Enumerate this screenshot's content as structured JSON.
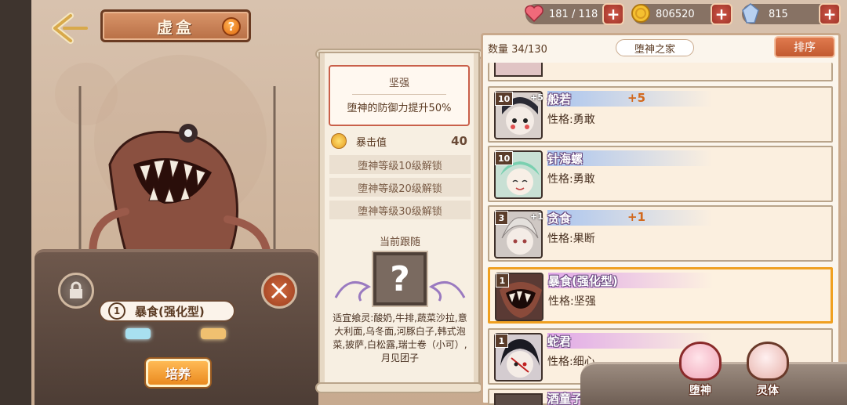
{
  "header": {
    "title": "虚盒",
    "help_icon": "question-icon",
    "back_icon": "back-arrow-icon"
  },
  "resources": {
    "stamina": {
      "value": "181 / 118",
      "icon": "heart-icon"
    },
    "gold": {
      "value": "806520",
      "icon": "coin-icon"
    },
    "crystal": {
      "value": "815",
      "icon": "crystal-icon"
    },
    "plus_label": "+"
  },
  "monster": {
    "level": "1",
    "name": "暴食(强化型)",
    "train_label": "培养"
  },
  "info": {
    "trait_title": "坚强",
    "trait_desc": "堕神的防御力提升50%",
    "crit_label": "暴击值",
    "crit_value": "40",
    "locks": [
      "堕神等级10级解锁",
      "堕神等级20级解锁",
      "堕神等级30级解锁"
    ],
    "follow_label": "当前跟随",
    "follow_placeholder": "?",
    "suitable_text": "适宜飨灵:酸奶,牛排,蔬菜沙拉,意大利面,乌冬面,河豚白子,韩式泡菜,披萨,白松露,瑞士卷（小可）,月见团子"
  },
  "list": {
    "count": "数量 34/130",
    "home_tag": "堕神之家",
    "sort_label": "排序",
    "cards": [
      {
        "level": "10",
        "plus_badge": "+5",
        "name": "般若",
        "plus_level": "+5",
        "personality": "性格:勇敢",
        "band": "blue",
        "selected": false
      },
      {
        "level": "10",
        "plus_badge": "",
        "name": "针海螺",
        "plus_level": "",
        "personality": "性格:勇敢",
        "band": "blue",
        "selected": false
      },
      {
        "level": "3",
        "plus_badge": "+1",
        "name": "贪食",
        "plus_level": "+1",
        "personality": "性格:果断",
        "band": "blue",
        "selected": false
      },
      {
        "level": "1",
        "plus_badge": "",
        "name": "暴食(强化型)",
        "plus_level": "",
        "personality": "性格:坚强",
        "band": "pink",
        "selected": true
      },
      {
        "level": "1",
        "plus_badge": "",
        "name": "蛇君",
        "plus_level": "",
        "personality": "性格:细心",
        "band": "pink",
        "selected": false
      }
    ],
    "partial_bottom_name": "酒童子"
  },
  "categories": [
    {
      "label": "堕神",
      "icon": "fallen-god-bowl-icon"
    },
    {
      "label": "灵体",
      "icon": "spirit-bowl-icon"
    }
  ],
  "colors": {
    "accent_orange": "#ea8a20",
    "selected_border": "#f0a020",
    "trait_border": "#c9604a"
  }
}
